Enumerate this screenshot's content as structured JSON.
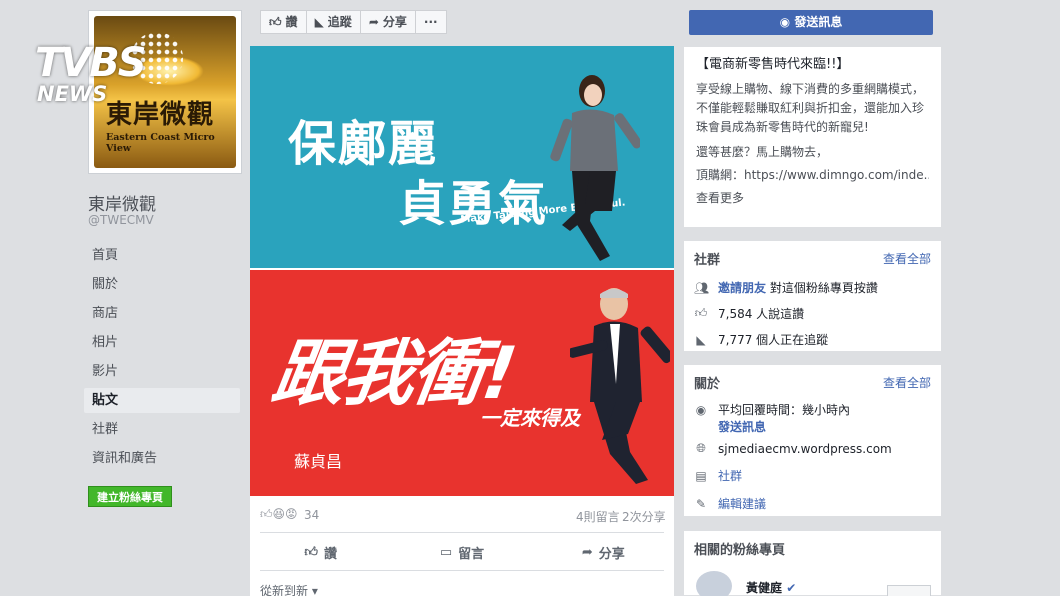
{
  "watermark": {
    "line1": "TVBS",
    "line2": "NEWS"
  },
  "page": {
    "logo_cn": "東岸微觀",
    "logo_en": "Eastern Coast Micro View",
    "name": "東岸微觀",
    "handle": "@TWECMV"
  },
  "nav": {
    "items": [
      "首頁",
      "關於",
      "商店",
      "相片",
      "影片",
      "貼文",
      "社群",
      "資訊和廣告"
    ],
    "active_index": 5,
    "create_page": "建立粉絲專頁"
  },
  "actionbar": {
    "like": "讚",
    "follow": "追蹤",
    "share": "分享",
    "more": "···"
  },
  "message_button": "發送訊息",
  "post": {
    "top_image": {
      "line1": "保鄺麗",
      "line2": "貞勇氣",
      "tagline": "Make Taitung More Beautiful."
    },
    "bottom_image": {
      "headline": "跟我衝!",
      "sub": "一定來得及",
      "name": "蘇貞昌"
    },
    "reactions_count": "34",
    "comments": "4則留言",
    "shares": "2次分享",
    "actions": {
      "like": "讚",
      "comment": "留言",
      "share": "分享"
    },
    "sort": "從新到新 ▾"
  },
  "promo": {
    "title": "【電商新零售時代來臨!!】",
    "body": "享受線上購物、線下消費的多重網購模式，不僅能輕鬆賺取紅利與折扣金，還能加入珍珠會員成為新零售時代的新寵兒!",
    "line2": "還等甚麼？馬上購物去，",
    "line3": "頂購網：https://www.dimngo.com/inde...",
    "more": "查看更多"
  },
  "community": {
    "title": "社群",
    "see_all": "查看全部",
    "invite": "邀請朋友",
    "invite_rest": "對這個粉絲專頁按讚",
    "likes": "7,584 人說這讚",
    "follows": "7,777 個人正在追蹤"
  },
  "about": {
    "title": "關於",
    "see_all": "查看全部",
    "response": "平均回覆時間：幾小時內",
    "send_msg": "發送訊息",
    "website": "sjmediaecmv.wordpress.com",
    "category": "社群",
    "suggest": "編輯建議"
  },
  "related": {
    "title": "相關的粉絲專頁",
    "first_name": "黃健庭"
  }
}
